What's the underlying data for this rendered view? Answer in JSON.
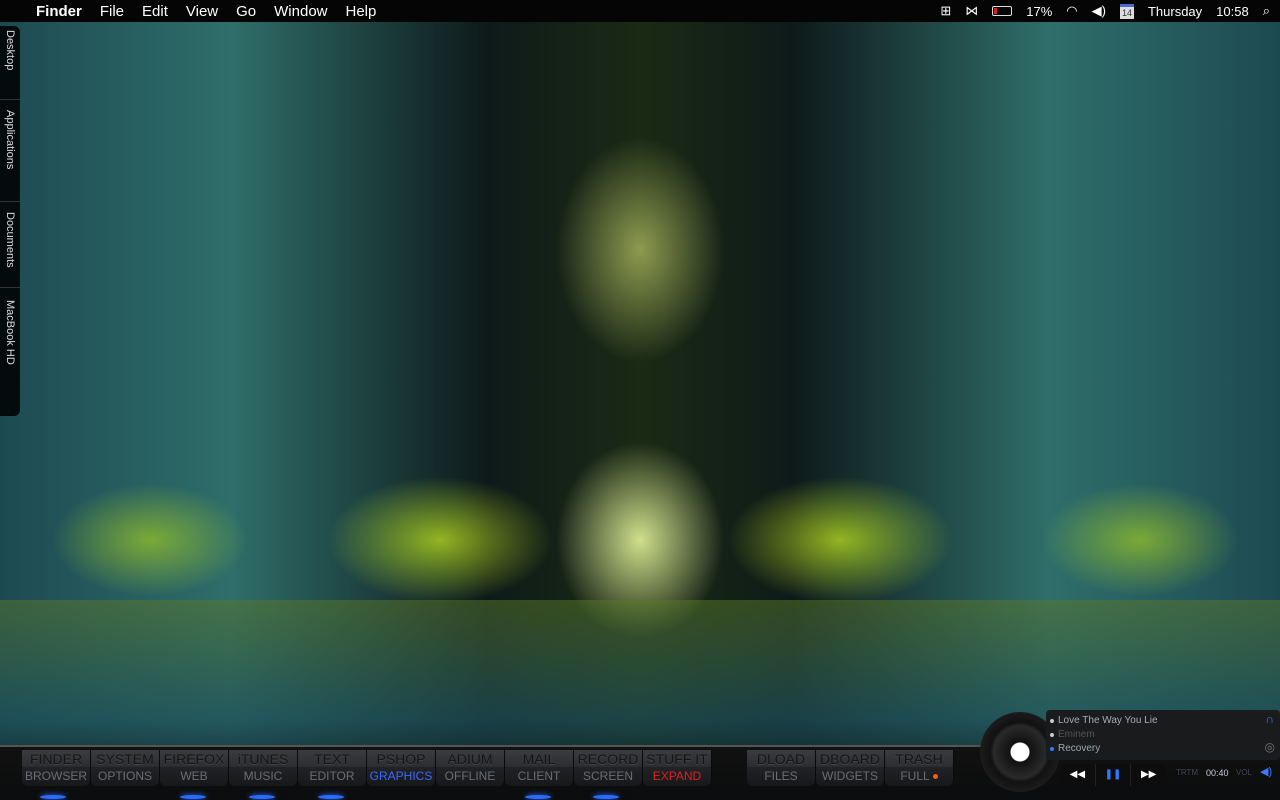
{
  "menubar": {
    "apple": "",
    "app": "Finder",
    "items": [
      "File",
      "Edit",
      "View",
      "Go",
      "Window",
      "Help"
    ],
    "battery": "17%",
    "day": "Thursday",
    "time": "10:58",
    "calendar_day": "14"
  },
  "sidebar": [
    "Desktop",
    "Applications",
    "Documents",
    "MacBook HD"
  ],
  "dock": [
    [
      "FINDER",
      "BROWSER"
    ],
    [
      "SYSTEM",
      "OPTIONS"
    ],
    [
      "FIREFOX",
      "WEB"
    ],
    [
      "iTUNES",
      "MUSIC"
    ],
    [
      "TEXT",
      "EDITOR"
    ],
    [
      "PSHOP",
      "GRAPHICS"
    ],
    [
      "ADIUM",
      "OFFLINE"
    ],
    [
      "MAIL",
      "CLIENT"
    ],
    [
      "RECORD",
      "SCREEN"
    ],
    [
      "STUFF IT",
      "EXPAND"
    ]
  ],
  "dock2": [
    [
      "DLOAD",
      "FILES"
    ],
    [
      "DBOARD",
      "WIDGETS"
    ],
    [
      "TRASH",
      "FULL"
    ]
  ],
  "colors": {
    "graphics": "#3a6bff",
    "expand": "#e02020",
    "trash_dot": "#ff5a10"
  },
  "player": {
    "track": "Love The Way You Lie",
    "artist": "Eminem",
    "album": "Recovery",
    "time_label": "TRTM",
    "time": "00:40",
    "vol_label": "VOL",
    "prev": "◀◀",
    "pause": "❚❚",
    "next": "▶▶"
  }
}
